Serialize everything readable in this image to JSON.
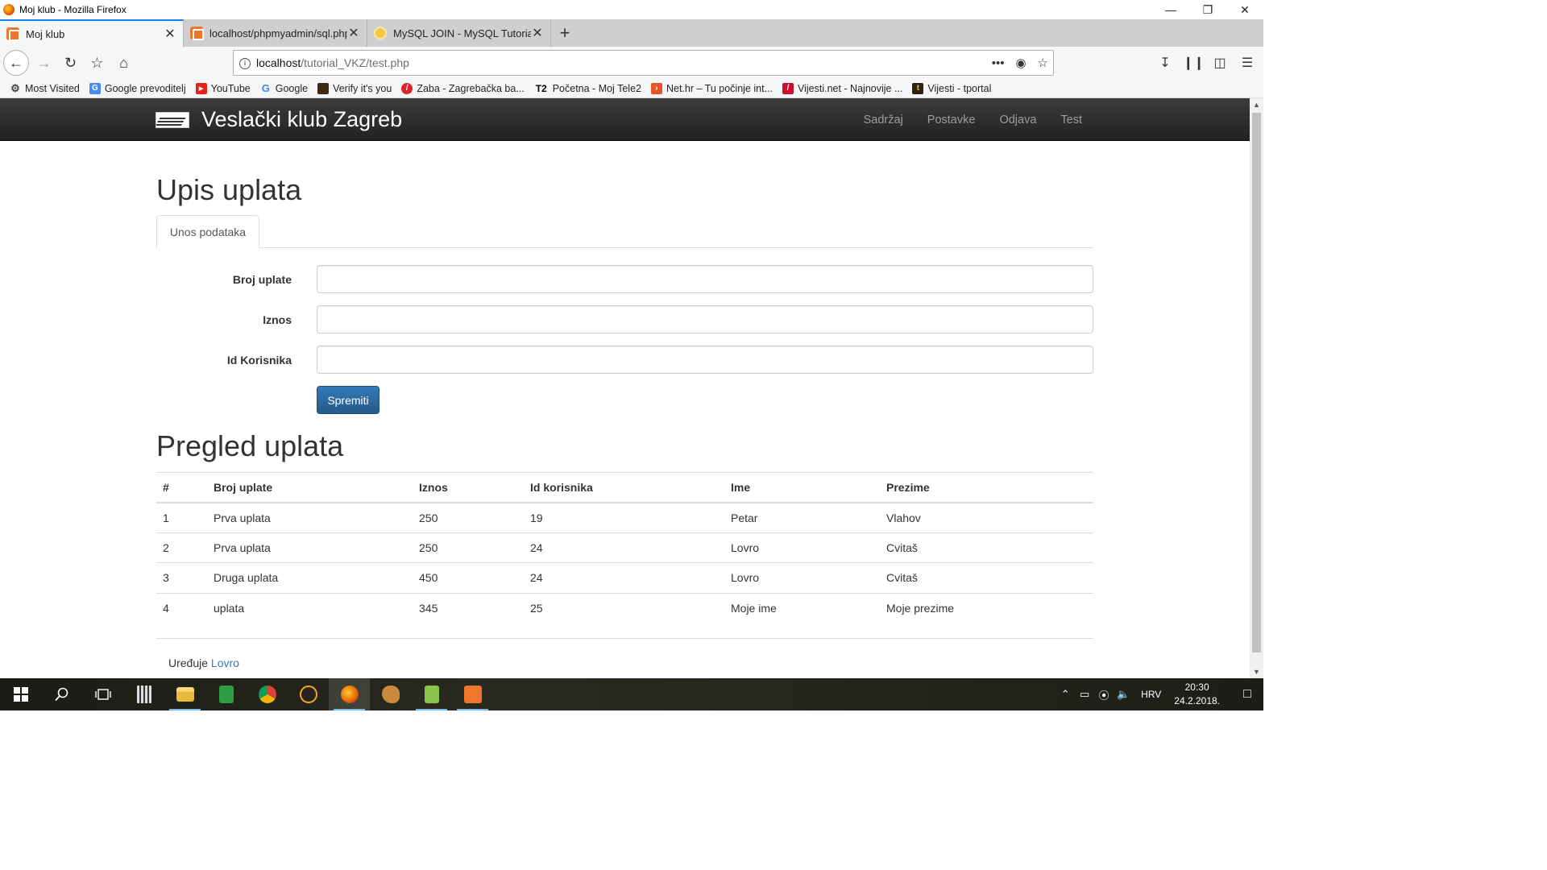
{
  "window": {
    "title": "Moj klub - Mozilla Firefox"
  },
  "tabs": [
    {
      "label": "Moj klub"
    },
    {
      "label": "localhost/phpmyadmin/sql.php"
    },
    {
      "label": "MySQL JOIN - MySQL Tutorial"
    }
  ],
  "url": {
    "host": "localhost",
    "path": "/tutorial_VKZ/test.php"
  },
  "bookmarks": [
    {
      "label": "Most Visited",
      "icon": "gear-icon"
    },
    {
      "label": "Google prevoditelj",
      "icon": "translate-icon"
    },
    {
      "label": "YouTube",
      "icon": "youtube-icon"
    },
    {
      "label": "Google",
      "icon": "google-icon"
    },
    {
      "label": "Verify it's you",
      "icon": "briefcase-icon"
    },
    {
      "label": "Zaba - Zagrebačka ba...",
      "icon": "zaba-icon"
    },
    {
      "label": "Početna - Moj Tele2",
      "icon": "tele2-icon"
    },
    {
      "label": "Net.hr – Tu počinje int...",
      "icon": "nethr-icon"
    },
    {
      "label": "Vijesti.net - Najnovije ...",
      "icon": "vijesti-icon"
    },
    {
      "label": "Vijesti - tportal",
      "icon": "tportal-icon"
    }
  ],
  "site": {
    "brand": "Veslački klub Zagreb",
    "menu": [
      "Sadržaj",
      "Postavke",
      "Odjava",
      "Test"
    ]
  },
  "form": {
    "heading": "Upis uplata",
    "tab": "Unos podataka",
    "fields": [
      {
        "label": "Broj uplate",
        "value": ""
      },
      {
        "label": "Iznos",
        "value": ""
      },
      {
        "label": "Id Korisnika",
        "value": ""
      }
    ],
    "submit": "Spremiti"
  },
  "table": {
    "heading": "Pregled uplata",
    "columns": [
      "#",
      "Broj uplate",
      "Iznos",
      "Id korisnika",
      "Ime",
      "Prezime"
    ],
    "rows": [
      [
        "1",
        "Prva uplata",
        "250",
        "19",
        "Petar",
        "Vlahov"
      ],
      [
        "2",
        "Prva uplata",
        "250",
        "24",
        "Lovro",
        "Cvitaš"
      ],
      [
        "3",
        "Druga uplata",
        "450",
        "24",
        "Lovro",
        "Cvitaš"
      ],
      [
        "4",
        "uplata",
        "345",
        "25",
        "Moje ime",
        "Moje prezime"
      ]
    ]
  },
  "footer": {
    "prefix": "Uređuje",
    "author": "Lovro"
  },
  "taskbar": {
    "lang": "HRV",
    "time": "20:30",
    "date": "24.2.2018."
  },
  "colors": {
    "accent": "#0a84ff",
    "primary_button": "#337ab7",
    "navbar_bg": "#222222",
    "link": "#337ab7"
  }
}
